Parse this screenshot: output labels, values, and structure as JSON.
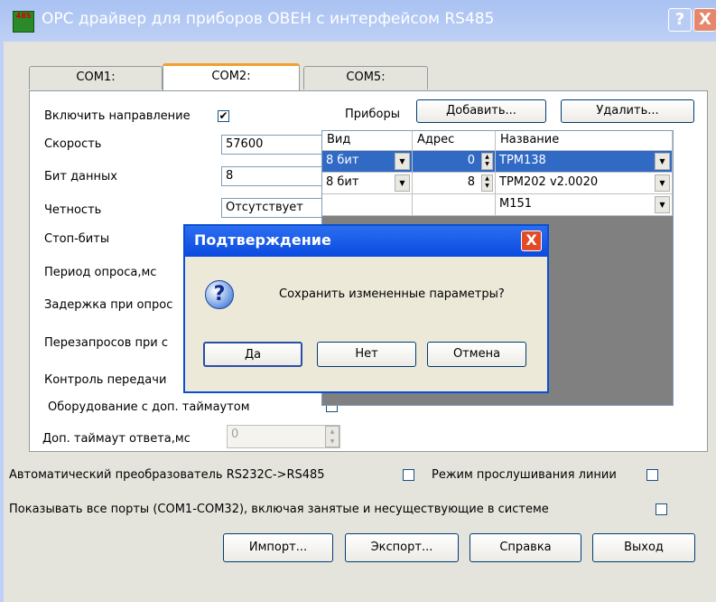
{
  "window": {
    "title": "OPC драйвер для приборов ОВЕН с интерфейсом RS485",
    "help": "?",
    "close": "X",
    "icon_text_top": "485",
    "icon_name": "app-logo-icon"
  },
  "tabs": [
    "COM1:",
    "COM2:",
    "COM5:"
  ],
  "settings": {
    "enable_direction": "Включить направление",
    "enable_direction_checked": "✔",
    "speed_label": "Скорость",
    "speed_value": "57600",
    "data_bits_label": "Бит данных",
    "data_bits_value": "8",
    "parity_label": "Четность",
    "parity_value": "Отсутствует",
    "stop_bits_label": "Стоп-биты",
    "poll_period_label": "Период опроса,мс",
    "poll_delay_label": "Задержка при опрос",
    "retries_label": "Перезапросов при с",
    "transfer_control_label": "Контроль передачи",
    "extra_timeout_equipment_label": "Оборудование с доп. таймаутом",
    "extra_timeout_label": "Доп. таймаут ответа,мс",
    "extra_timeout_value": "0"
  },
  "devices": {
    "label": "Приборы",
    "add": "Добавить...",
    "remove": "Удалить...",
    "columns": [
      "Вид",
      "Адрес",
      "Название"
    ],
    "rows": [
      {
        "type": "8 бит",
        "address": "0",
        "name": "ТРМ138"
      },
      {
        "type": "8 бит",
        "address": "8",
        "name": "ТРМ202 v2.0020"
      },
      {
        "type": "",
        "address": "",
        "name": "М151"
      }
    ]
  },
  "bottom": {
    "auto_converter": "Автоматический преобразователь RS232C->RS485",
    "listen_mode": "Режим прослушивания линии",
    "show_all_ports": "Показывать все порты (COM1-COM32), включая занятые и несуществующие в системе",
    "import": "Импорт...",
    "export": "Экспорт...",
    "help": "Справка",
    "exit": "Выход"
  },
  "dialog": {
    "title": "Подтверждение",
    "close": "X",
    "icon": "question-icon",
    "icon_glyph": "?",
    "message": "Сохранить измененные параметры?",
    "yes": "Да",
    "no": "Нет",
    "cancel": "Отмена"
  },
  "colors": {
    "selection": "#316ac5",
    "title_blue": "#0a4ae0",
    "tab_accent": "#f0a030"
  }
}
